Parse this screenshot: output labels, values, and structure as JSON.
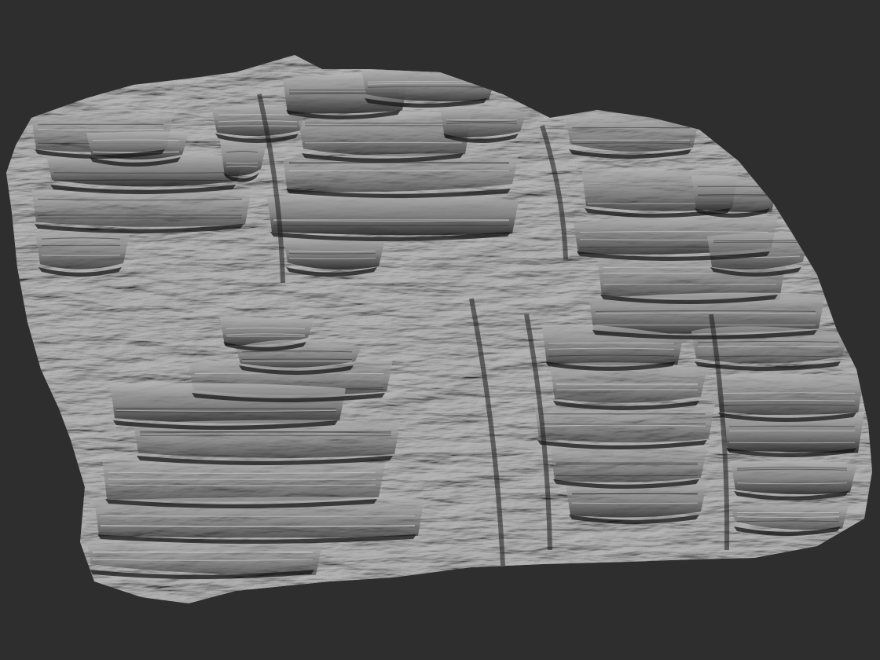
{
  "viewport": {
    "background_color": "#2e2e2e",
    "material_color": "#8a8a8a",
    "shadow_color": "#1a1a1a",
    "highlight_color": "#c8c8c8"
  },
  "model": {
    "subject": "sculpted-rock-cliff-mesh"
  }
}
